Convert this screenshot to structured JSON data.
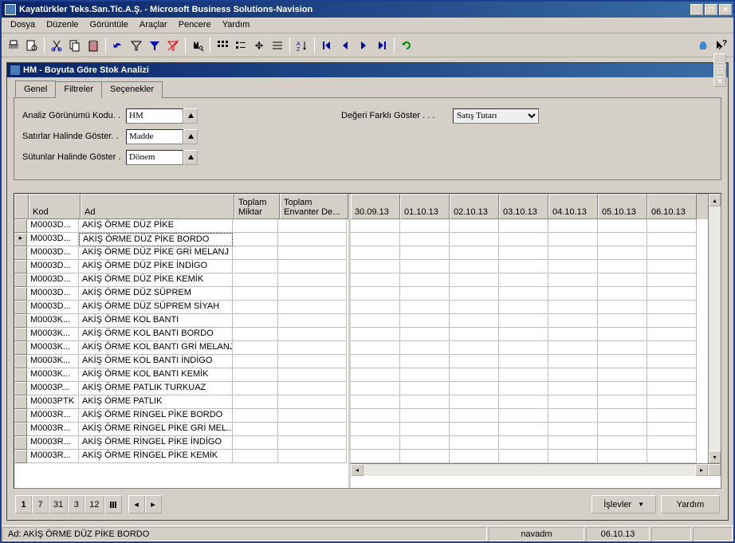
{
  "app": {
    "title": "Kayatürkler Teks.San.Tic.A.Ş. - Microsoft Business Solutions-Navision"
  },
  "menu": {
    "file": "Dosya",
    "edit": "Düzenle",
    "view": "Görüntüle",
    "tools": "Araçlar",
    "window": "Pencere",
    "help": "Yardım"
  },
  "subwindow": {
    "title": "HM - Boyuta Göre Stok Analizi"
  },
  "tabs": {
    "general": "Genel",
    "filters": "Filtreler",
    "options": "Seçenekler"
  },
  "form": {
    "analysis_view_code_label": "Analiz Görünümü Kodu. .",
    "analysis_view_code_value": "HM",
    "show_lines_label": "Satırlar Halinde Göster. .",
    "show_lines_value": "Madde",
    "show_columns_label": "Sütunlar Halinde Göster .",
    "show_columns_value": "Dönem",
    "show_value_label": "Değeri Farklı Göster . . .",
    "show_value_value": "Satış Tutarı"
  },
  "grid": {
    "headers": {
      "kod": "Kod",
      "ad": "Ad",
      "toplam_miktar": "Toplam Miktar",
      "toplam_envanter": "Toplam Envanter De..."
    },
    "date_headers": [
      "30.09.13",
      "01.10.13",
      "02.10.13",
      "03.10.13",
      "04.10.13",
      "05.10.13",
      "06.10.13"
    ],
    "rows": [
      {
        "kod": "M0003D...",
        "ad": "AKİŞ ÖRME DÜZ PİKE"
      },
      {
        "kod": "M0003D...",
        "ad": "AKİŞ ÖRME DÜZ PİKE BORDO",
        "selected": true
      },
      {
        "kod": "M0003D...",
        "ad": "AKİŞ ÖRME DÜZ PİKE GRİ MELANJ"
      },
      {
        "kod": "M0003D...",
        "ad": "AKİŞ ÖRME DÜZ PİKE İNDİGO"
      },
      {
        "kod": "M0003D...",
        "ad": "AKİŞ ÖRME DÜZ PİKE KEMİK"
      },
      {
        "kod": "M0003D...",
        "ad": "AKİŞ ÖRME DÜZ SÜPREM"
      },
      {
        "kod": "M0003D...",
        "ad": "AKİŞ ÖRME DÜZ SÜPREM SİYAH"
      },
      {
        "kod": "M0003K...",
        "ad": "AKİŞ ÖRME KOL BANTI"
      },
      {
        "kod": "M0003K...",
        "ad": "AKİŞ ÖRME KOL BANTI BORDO"
      },
      {
        "kod": "M0003K...",
        "ad": "AKİŞ ÖRME KOL BANTI GRİ MELANJ"
      },
      {
        "kod": "M0003K...",
        "ad": "AKİŞ ÖRME KOL BANTI İNDİGO"
      },
      {
        "kod": "M0003K...",
        "ad": "AKİŞ ÖRME KOL BANTI KEMİK"
      },
      {
        "kod": "M0003P...",
        "ad": "AKİŞ ÖRME PATLIK TURKUAZ"
      },
      {
        "kod": "M0003PTK",
        "ad": "AKİŞ ÖRME PATLIK"
      },
      {
        "kod": "M0003R...",
        "ad": "AKİŞ ÖRME RİNGEL PİKE BORDO"
      },
      {
        "kod": "M0003R...",
        "ad": "AKİŞ ÖRME RİNGEL PİKE GRİ MEL..."
      },
      {
        "kod": "M0003R...",
        "ad": "AKİŞ ÖRME RİNGEL PİKE İNDİGO"
      },
      {
        "kod": "M0003R...",
        "ad": "AKİŞ ÖRME RİNGEL PİKE KEMİK"
      }
    ]
  },
  "pager": {
    "p1": "1",
    "p7": "7",
    "p31": "31",
    "p3": "3",
    "p12": "12"
  },
  "buttons": {
    "functions": "İşlevler",
    "help": "Yardım"
  },
  "statusbar": {
    "detail": "Ad: AKİŞ ÖRME DÜZ PİKE BORDO",
    "user": "navadm",
    "date": "06.10.13"
  }
}
